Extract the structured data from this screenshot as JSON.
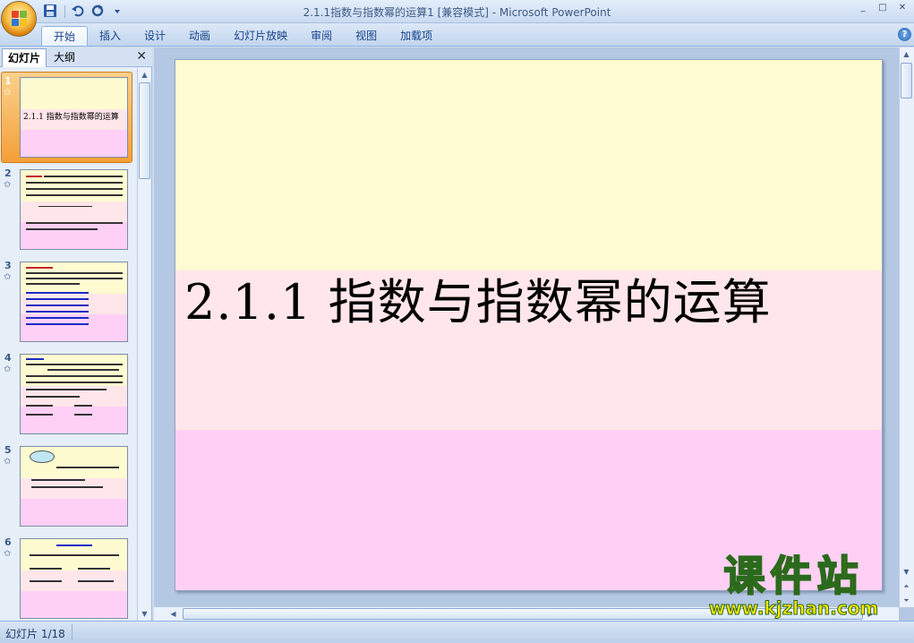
{
  "window": {
    "title": "2.1.1指数与指数幂的运算1 [兼容模式] - Microsoft PowerPoint",
    "controls": [
      "_",
      "□",
      "✕"
    ],
    "inner_controls": [
      "_",
      "□",
      "✕"
    ]
  },
  "quick_access": {
    "icons": [
      "save-icon",
      "undo-icon",
      "redo-icon",
      "customize-icon"
    ]
  },
  "ribbon": {
    "tabs": [
      "开始",
      "插入",
      "设计",
      "动画",
      "幻灯片放映",
      "审阅",
      "视图",
      "加载项"
    ],
    "active_tab": "开始",
    "help": "?"
  },
  "left_pane": {
    "tabs": [
      "幻灯片",
      "大纲"
    ],
    "close": "✕",
    "thumbnails": [
      {
        "number": "1",
        "title": "2.1.1  指数与指数幂的运算"
      },
      {
        "number": "2"
      },
      {
        "number": "3"
      },
      {
        "number": "4"
      },
      {
        "number": "5"
      },
      {
        "number": "6"
      }
    ]
  },
  "slide": {
    "title": "2.1.1  指数与指数幂的运算"
  },
  "status": {
    "slide_info": "幻灯片 1/18"
  },
  "watermark": {
    "brand": "课件站",
    "url": "www.kjzhan.com"
  },
  "colors": {
    "band_top": "#fffbd2",
    "band_middle": "#ffe6ea",
    "band_bottom": "#ffd0f4",
    "selection": "#f59f38",
    "watermark": "#ffe600"
  }
}
